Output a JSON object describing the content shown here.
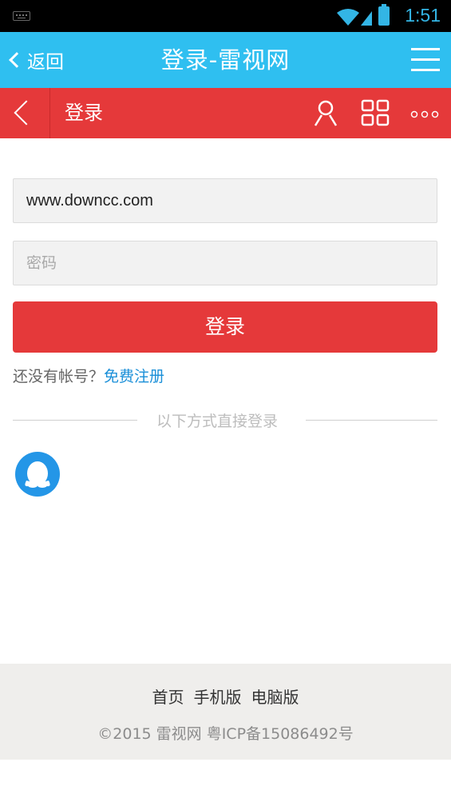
{
  "status_bar": {
    "time": "1:51"
  },
  "top_bar": {
    "back_label": "返回",
    "title": "登录-雷视网"
  },
  "header": {
    "title": "登录"
  },
  "form": {
    "username_value": "www.downcc.com",
    "password_placeholder": "密码",
    "login_button": "登录",
    "no_account_text": "还没有帐号？",
    "register_link": "免费注册",
    "divider_text": "以下方式直接登录"
  },
  "footer": {
    "links": [
      "首页",
      "手机版",
      "电脑版"
    ],
    "copyright": "©2015 雷视网 粤ICP备15086492号"
  },
  "colors": {
    "top_bar": "#2fbff0",
    "accent_red": "#e5393a",
    "link_blue": "#1a8fd8",
    "qq_blue": "#2496e7"
  }
}
